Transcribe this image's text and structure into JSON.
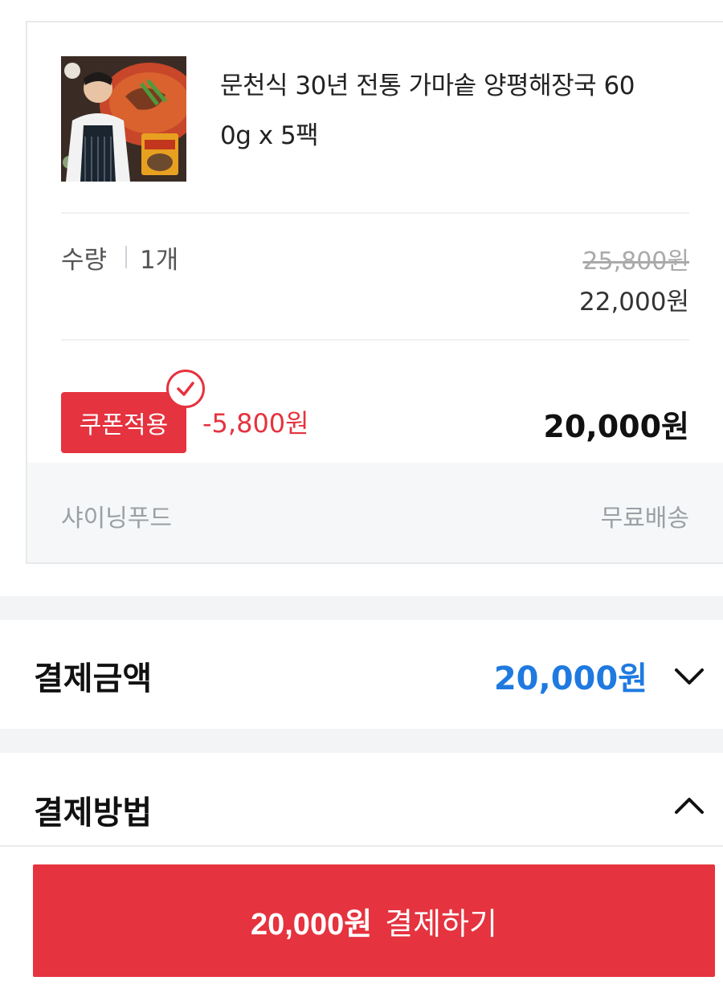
{
  "product": {
    "name_line1": "문천식 30년 전통 가마솥 양평해장국 60",
    "name_line2": "0g x 5팩",
    "thumbnail_icon": "product-photo"
  },
  "quantity": {
    "label": "수량",
    "value": "1개"
  },
  "price": {
    "original": "25,800원",
    "sale": "22,000원"
  },
  "coupon": {
    "badge_label": "쿠폰적용",
    "discount": "-5,800원",
    "final": "20,000원"
  },
  "seller": {
    "name": "샤이닝푸드",
    "shipping": "무료배송"
  },
  "payment_amount": {
    "title": "결제금액",
    "total": "20,000원"
  },
  "payment_method": {
    "title": "결제방법"
  },
  "pay_button": {
    "amount": "20,000원",
    "label": "결제하기"
  },
  "colors": {
    "accent_red": "#e5333f",
    "accent_blue": "#1f7ae0"
  }
}
